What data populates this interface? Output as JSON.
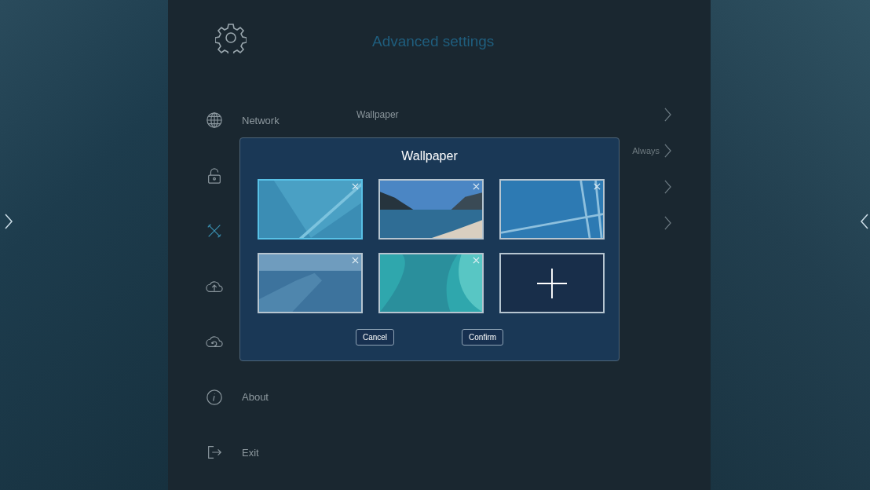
{
  "title": "Advanced settings",
  "sidebar": {
    "items": [
      {
        "kind": "globe",
        "label": "Network",
        "selected": false
      },
      {
        "kind": "lock",
        "selected": false
      },
      {
        "kind": "tools",
        "selected": true
      },
      {
        "kind": "cloud-up",
        "selected": false
      },
      {
        "kind": "cloud-refresh",
        "selected": false
      },
      {
        "kind": "info",
        "label": "About",
        "selected": false
      },
      {
        "kind": "exit",
        "label": "Exit",
        "selected": false
      }
    ]
  },
  "settings_rows": [
    {
      "label": "Wallpaper"
    },
    {
      "value": "Always"
    },
    {},
    {}
  ],
  "dialog": {
    "title": "Wallpaper",
    "wallpapers": [
      {
        "kind": "geometric",
        "selected": true
      },
      {
        "kind": "lake",
        "selected": false
      },
      {
        "kind": "grid",
        "selected": false
      },
      {
        "kind": "ice",
        "selected": false
      },
      {
        "kind": "curves",
        "selected": false
      }
    ],
    "buttons": [
      "Cancel",
      "Confirm"
    ]
  }
}
